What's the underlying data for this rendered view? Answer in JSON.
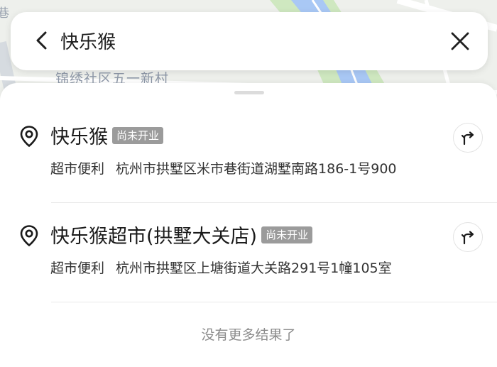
{
  "map": {
    "label_top_left": "巷",
    "label_area": "锦绣社区五一新村"
  },
  "search": {
    "query": "快乐猴",
    "back_icon": "chevron-left-icon",
    "clear_icon": "close-icon"
  },
  "results": [
    {
      "title": "快乐猴",
      "badge": "尚未开业",
      "category": "超市便利",
      "address": "杭州市拱墅区米市巷街道湖墅南路186-1号900",
      "pin_icon": "location-pin-icon",
      "route_icon": "route-icon"
    },
    {
      "title": "快乐猴超市(拱墅大关店)",
      "badge": "尚未开业",
      "category": "超市便利",
      "address": "杭州市拱墅区上塘街道大关路291号1幢105室",
      "pin_icon": "location-pin-icon",
      "route_icon": "route-icon"
    }
  ],
  "footer": {
    "no_more_text": "没有更多结果了"
  },
  "colors": {
    "badge_bg": "#9b9b9b",
    "map_road": "#ffffff",
    "map_water": "#a9c8f5",
    "map_green": "#cfe8c0"
  }
}
